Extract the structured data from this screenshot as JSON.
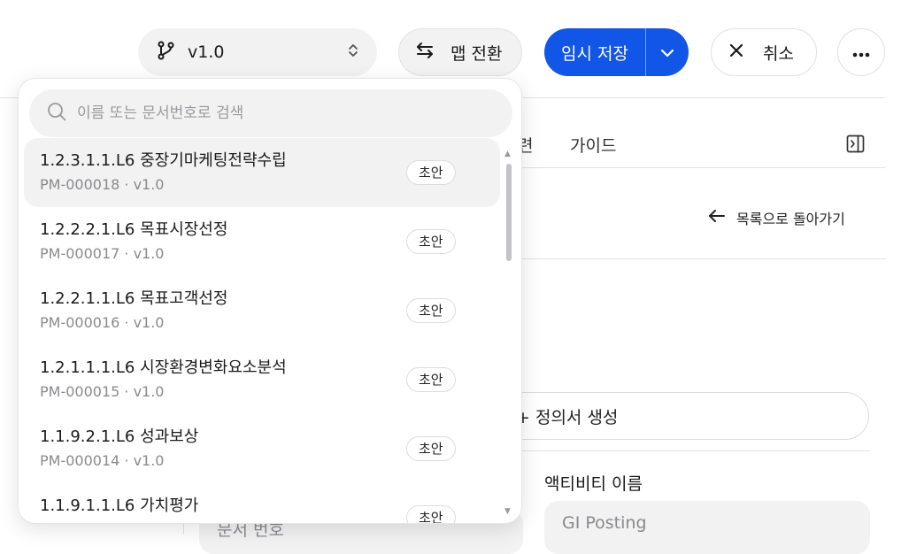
{
  "toolbar": {
    "version_label": "v1.0",
    "map_toggle_label": "맵 전환",
    "save_draft_label": "임시 저장",
    "cancel_label": "취소"
  },
  "page": {
    "tab_partial": "련",
    "tab_guide": "가이드",
    "back_to_list": "목록으로 돌아가기",
    "generate_definition": "+ 정의서 생성",
    "activity_name_label": "액티비티 이름",
    "activity_name_value": "GI Posting",
    "doc_number_label": "문서 번호"
  },
  "dropdown": {
    "search_placeholder": "이름 또는 문서번호로 검색",
    "items": [
      {
        "title": "1.2.3.1.1.L6 중장기마케팅전략수립",
        "sub": "PM-000018 · v1.0",
        "badge": "초안"
      },
      {
        "title": "1.2.2.2.1.L6 목표시장선정",
        "sub": "PM-000017 · v1.0",
        "badge": "초안"
      },
      {
        "title": "1.2.2.1.1.L6 목표고객선정",
        "sub": "PM-000016 · v1.0",
        "badge": "초안"
      },
      {
        "title": "1.2.1.1.1.L6 시장환경변화요소분석",
        "sub": "PM-000015 · v1.0",
        "badge": "초안"
      },
      {
        "title": "1.1.9.2.1.L6 성과보상",
        "sub": "PM-000014 · v1.0",
        "badge": "초안"
      },
      {
        "title": "1.1.9.1.1.L6 가치평가",
        "sub": "",
        "badge": "초안"
      }
    ]
  },
  "colors": {
    "primary": "#1256e8",
    "surface": "#f2f2f3",
    "border": "#e3e3e6",
    "muted_text": "#8a8a8e"
  }
}
